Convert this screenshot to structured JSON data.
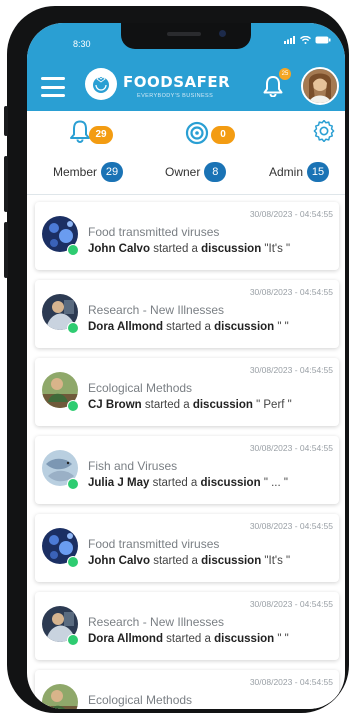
{
  "status_bar": {
    "time": "8:30"
  },
  "header": {
    "brand": "FOODSAFER",
    "tagline": "EVERYBODY'S BUSINESS",
    "notification_count": "25",
    "colors": {
      "primary": "#2a9fd3",
      "accent": "#f5a623",
      "role_badge": "#1a73b5",
      "online": "#2ecc71"
    }
  },
  "stats": {
    "notifications": "29",
    "targets": "0",
    "settings_icon": "gear-icon"
  },
  "roles": [
    {
      "label": "Member",
      "count": "29"
    },
    {
      "label": "Owner",
      "count": "8"
    },
    {
      "label": "Admin",
      "count": "15"
    }
  ],
  "feed": [
    {
      "time": "30/08/2023 - 04:54:55",
      "topic": "Food transmitted viruses",
      "user": "John Calvo",
      "action": "started a",
      "object": "discussion",
      "snippet": "\"It's \""
    },
    {
      "time": "30/08/2023 - 04:54:55",
      "topic": "Research - New Illnesses",
      "user": "Dora Allmond",
      "action": "started a",
      "object": "discussion",
      "snippet": "\" \""
    },
    {
      "time": "30/08/2023 - 04:54:55",
      "topic": "Ecological Methods",
      "user": "CJ Brown",
      "action": "started a",
      "object": "discussion",
      "snippet": "\" Perf \""
    },
    {
      "time": "30/08/2023 - 04:54:55",
      "topic": "Fish and Viruses",
      "user": "Julia J May",
      "action": "started a",
      "object": "discussion",
      "snippet": "\" ... \""
    },
    {
      "time": "30/08/2023 - 04:54:55",
      "topic": "Food transmitted viruses",
      "user": "John Calvo",
      "action": "started a",
      "object": "discussion",
      "snippet": "\"It's \""
    },
    {
      "time": "30/08/2023 - 04:54:55",
      "topic": "Research - New Illnesses",
      "user": "Dora Allmond",
      "action": "started a",
      "object": "discussion",
      "snippet": "\" \""
    },
    {
      "time": "30/08/2023 - 04:54:55",
      "topic": "Ecological Methods",
      "user": "",
      "action": "",
      "object": "",
      "snippet": ""
    }
  ]
}
